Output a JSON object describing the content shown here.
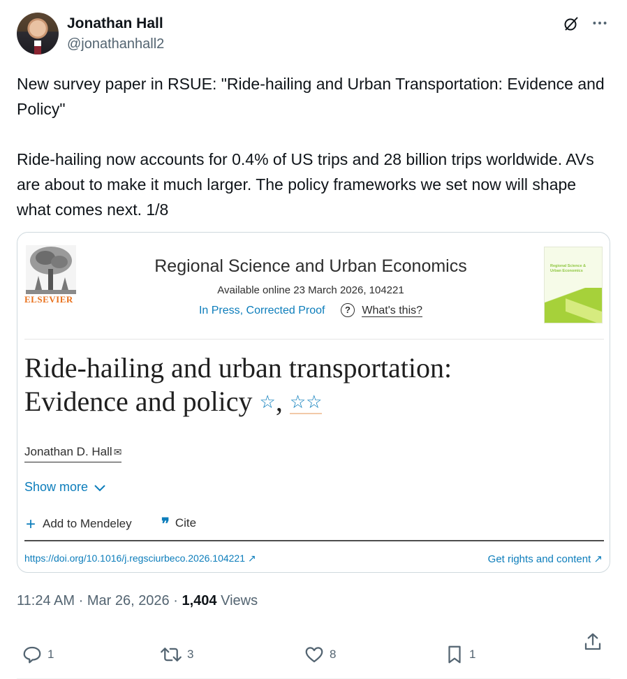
{
  "author": {
    "name": "Jonathan Hall",
    "handle": "@jonathanhall2"
  },
  "header_icons": [
    "grok-icon",
    "more-options-icon"
  ],
  "tweet": {
    "text": "New survey paper in RSUE: \"Ride-hailing and Urban Transportation: Evidence and Policy\"\n\nRide-hailing now accounts for 0.4% of US trips and 28 billion trips worldwide. AVs are about to make it much larger. The policy frameworks we set now will shape what comes next. 1/8"
  },
  "card": {
    "publisher": "ELSEVIER",
    "journal": "Regional Science and Urban Economics",
    "availability": "Available online 23 March 2026, 104221",
    "status": "In Press, Corrected Proof",
    "help_icon": "?",
    "help_label": "What's this?",
    "cover_title": "Regional Science & Urban Economics",
    "title_line1": "Ride-hailing and urban transportation:",
    "title_line2": "Evidence and policy",
    "title_star1": "☆",
    "title_sep": ",",
    "title_star2": "☆☆",
    "paper_author": "Jonathan D. Hall",
    "show_more": "Show more",
    "add_to_mendeley": "Add to Mendeley",
    "cite_glyph": "❞",
    "cite": "Cite",
    "doi": "https://doi.org/10.1016/j.regsciurbeco.2026.104221 ↗",
    "rights": "Get rights and content ↗",
    "colors": {
      "link": "#0c7dbb",
      "publisher_orange": "#e9711c",
      "cover_green": "#a6d13a"
    }
  },
  "meta": {
    "time": "11:24 AM",
    "date": "Mar 26, 2026",
    "views_count": "1,404",
    "views_label": "Views",
    "separator": "·"
  },
  "actions": {
    "replies": "1",
    "reposts": "3",
    "likes": "8",
    "bookmarks": "1"
  },
  "colors": {
    "text": "#0f1419",
    "muted": "#536471",
    "border": "#cfd9de"
  }
}
